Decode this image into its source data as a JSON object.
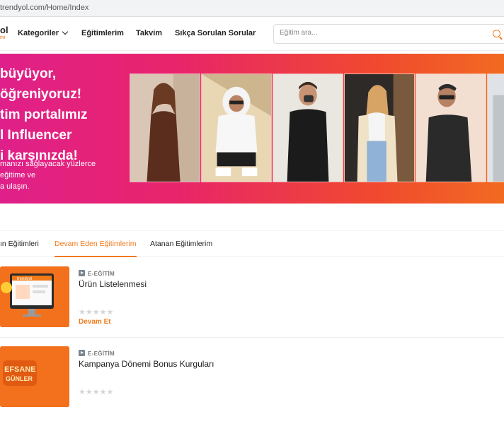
{
  "browser": {
    "url": "trendyol.com/Home/Index"
  },
  "logo": {
    "line1": "ol",
    "line2": "mi"
  },
  "nav": {
    "items": [
      "Kategoriler",
      "Eğitimlerim",
      "Takvim",
      "Sıkça Sorulan Sorular"
    ],
    "search_placeholder": "Eğitim ara..."
  },
  "banner": {
    "headline": [
      "büyüyor,",
      "öğreniyoruz!",
      "tim portalımız",
      "l Influencer",
      "i karşınızda!"
    ],
    "subtext": [
      "manızı sağlayacak yüzlerce",
      "eğitime ve",
      "a ulaşın."
    ],
    "accent": "#f27a1a"
  },
  "tabs": {
    "items": [
      "ın Eğitimleri",
      "Devam Eden Eğitimlerim",
      "Atanan Eğitimlerim"
    ],
    "active_index": 1
  },
  "courses": [
    {
      "type": "E-EĞİTİM",
      "title": "Ürün Listelenmesi",
      "rating": 0,
      "stars": "★★★★★",
      "action": "Devam Et",
      "thumb_label": "trendyol"
    },
    {
      "type": "E-EĞİTİM",
      "title": "Kampanya Dönemi Bonus Kurguları",
      "rating": 0,
      "stars": "★★★★★",
      "thumb_label_1": "EFSANE",
      "thumb_label_2": "GÜNLER"
    }
  ]
}
